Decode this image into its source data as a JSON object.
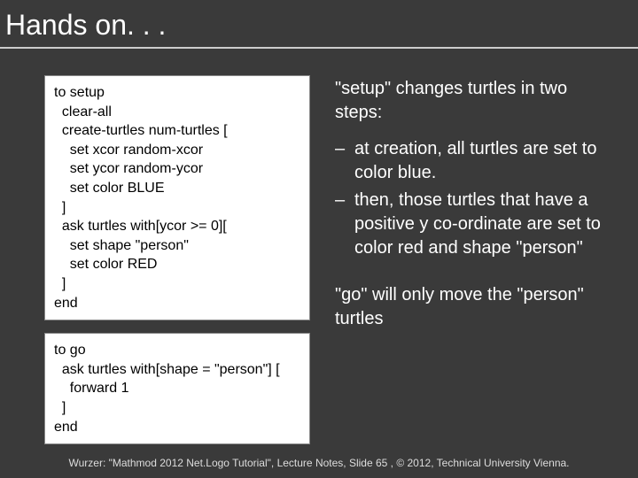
{
  "title": "Hands on. . .",
  "code1": "to setup\n  clear-all\n  create-turtles num-turtles [\n    set xcor random-xcor\n    set ycor random-ycor\n    set color BLUE\n  ]\n  ask turtles with[ycor >= 0][\n    set shape \"person\"\n    set color RED\n  ]\nend",
  "code2": "to go\n  ask turtles with[shape = \"person\"] [\n    forward 1\n  ]\nend",
  "explain": {
    "intro": "\"setup\" changes turtles in two steps:",
    "b1": "at creation, all turtles are set to color blue.",
    "b2": "then, those turtles that have a positive y co-ordinate are set to color red and shape \"person\"",
    "go": "\"go\" will only move the \"person\" turtles"
  },
  "footer": "Wurzer: \"Mathmod 2012 Net.Logo Tutorial\", Lecture Notes, Slide 65 , © 2012, Technical University Vienna."
}
